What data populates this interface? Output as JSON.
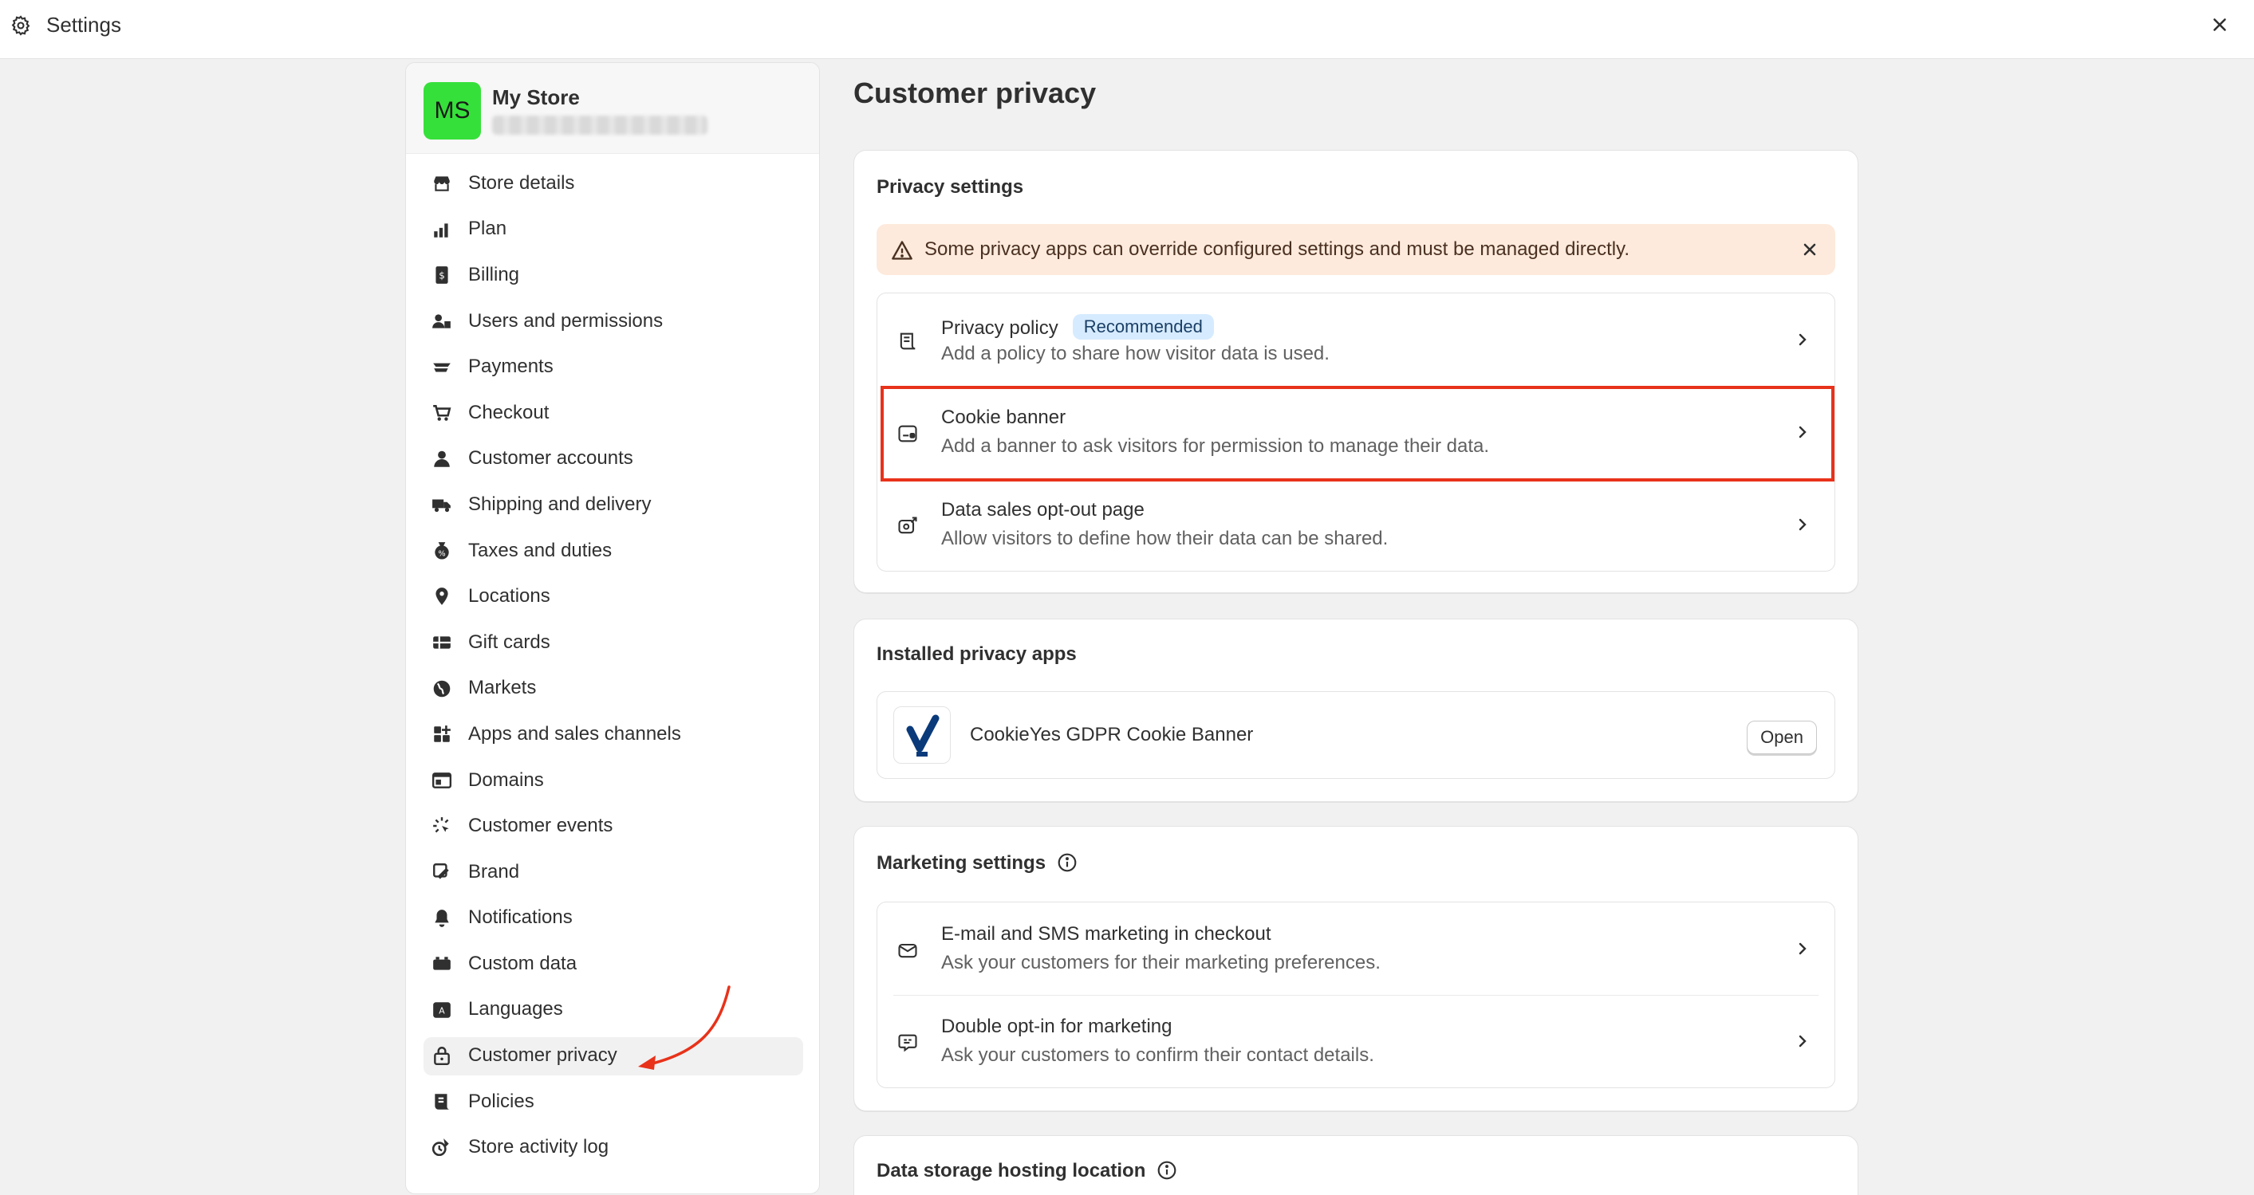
{
  "window": {
    "title": "Settings"
  },
  "store": {
    "initials": "MS",
    "name": "My Store"
  },
  "sidebar": {
    "items": [
      {
        "label": "Store details",
        "icon": "store-icon"
      },
      {
        "label": "Plan",
        "icon": "plan-icon"
      },
      {
        "label": "Billing",
        "icon": "billing-icon"
      },
      {
        "label": "Users and permissions",
        "icon": "users-icon"
      },
      {
        "label": "Payments",
        "icon": "payments-icon"
      },
      {
        "label": "Checkout",
        "icon": "cart-icon"
      },
      {
        "label": "Customer accounts",
        "icon": "person-icon"
      },
      {
        "label": "Shipping and delivery",
        "icon": "truck-icon"
      },
      {
        "label": "Taxes and duties",
        "icon": "tax-icon"
      },
      {
        "label": "Locations",
        "icon": "location-icon"
      },
      {
        "label": "Gift cards",
        "icon": "gift-card-icon"
      },
      {
        "label": "Markets",
        "icon": "globe-icon"
      },
      {
        "label": "Apps and sales channels",
        "icon": "apps-icon"
      },
      {
        "label": "Domains",
        "icon": "domains-icon"
      },
      {
        "label": "Customer events",
        "icon": "cursor-icon"
      },
      {
        "label": "Brand",
        "icon": "brand-icon"
      },
      {
        "label": "Notifications",
        "icon": "bell-icon"
      },
      {
        "label": "Custom data",
        "icon": "custom-data-icon"
      },
      {
        "label": "Languages",
        "icon": "language-icon"
      },
      {
        "label": "Customer privacy",
        "icon": "lock-icon",
        "active": true
      },
      {
        "label": "Policies",
        "icon": "policies-icon"
      },
      {
        "label": "Store activity log",
        "icon": "activity-log-icon"
      }
    ]
  },
  "main": {
    "title": "Customer privacy",
    "privacy_settings": {
      "title": "Privacy settings",
      "warning": "Some privacy apps can override configured settings and must be managed directly.",
      "rows": [
        {
          "title": "Privacy policy",
          "badge": "Recommended",
          "description": "Add a policy to share how visitor data is used.",
          "icon": "scroll-icon"
        },
        {
          "title": "Cookie banner",
          "description": "Add a banner to ask visitors for permission to manage their data.",
          "icon": "cookie-banner-icon"
        },
        {
          "title": "Data sales opt-out page",
          "description": "Allow visitors to define how their data can be shared.",
          "icon": "data-share-icon"
        }
      ]
    },
    "installed_apps": {
      "title": "Installed privacy apps",
      "app_name": "CookieYes GDPR Cookie Banner",
      "open_label": "Open"
    },
    "marketing_settings": {
      "title": "Marketing settings",
      "rows": [
        {
          "title": "E-mail and SMS marketing in checkout",
          "description": "Ask your customers for their marketing preferences.",
          "icon": "mail-icon"
        },
        {
          "title": "Double opt-in for marketing",
          "description": "Ask your customers to confirm their contact details.",
          "icon": "chat-icon"
        }
      ]
    },
    "data_storage": {
      "title": "Data storage hosting location"
    }
  },
  "colors": {
    "avatar": "#36e03a",
    "highlight": "#e8321a",
    "warning_bg": "#fdeadc",
    "badge_bg": "#d6ebff"
  }
}
